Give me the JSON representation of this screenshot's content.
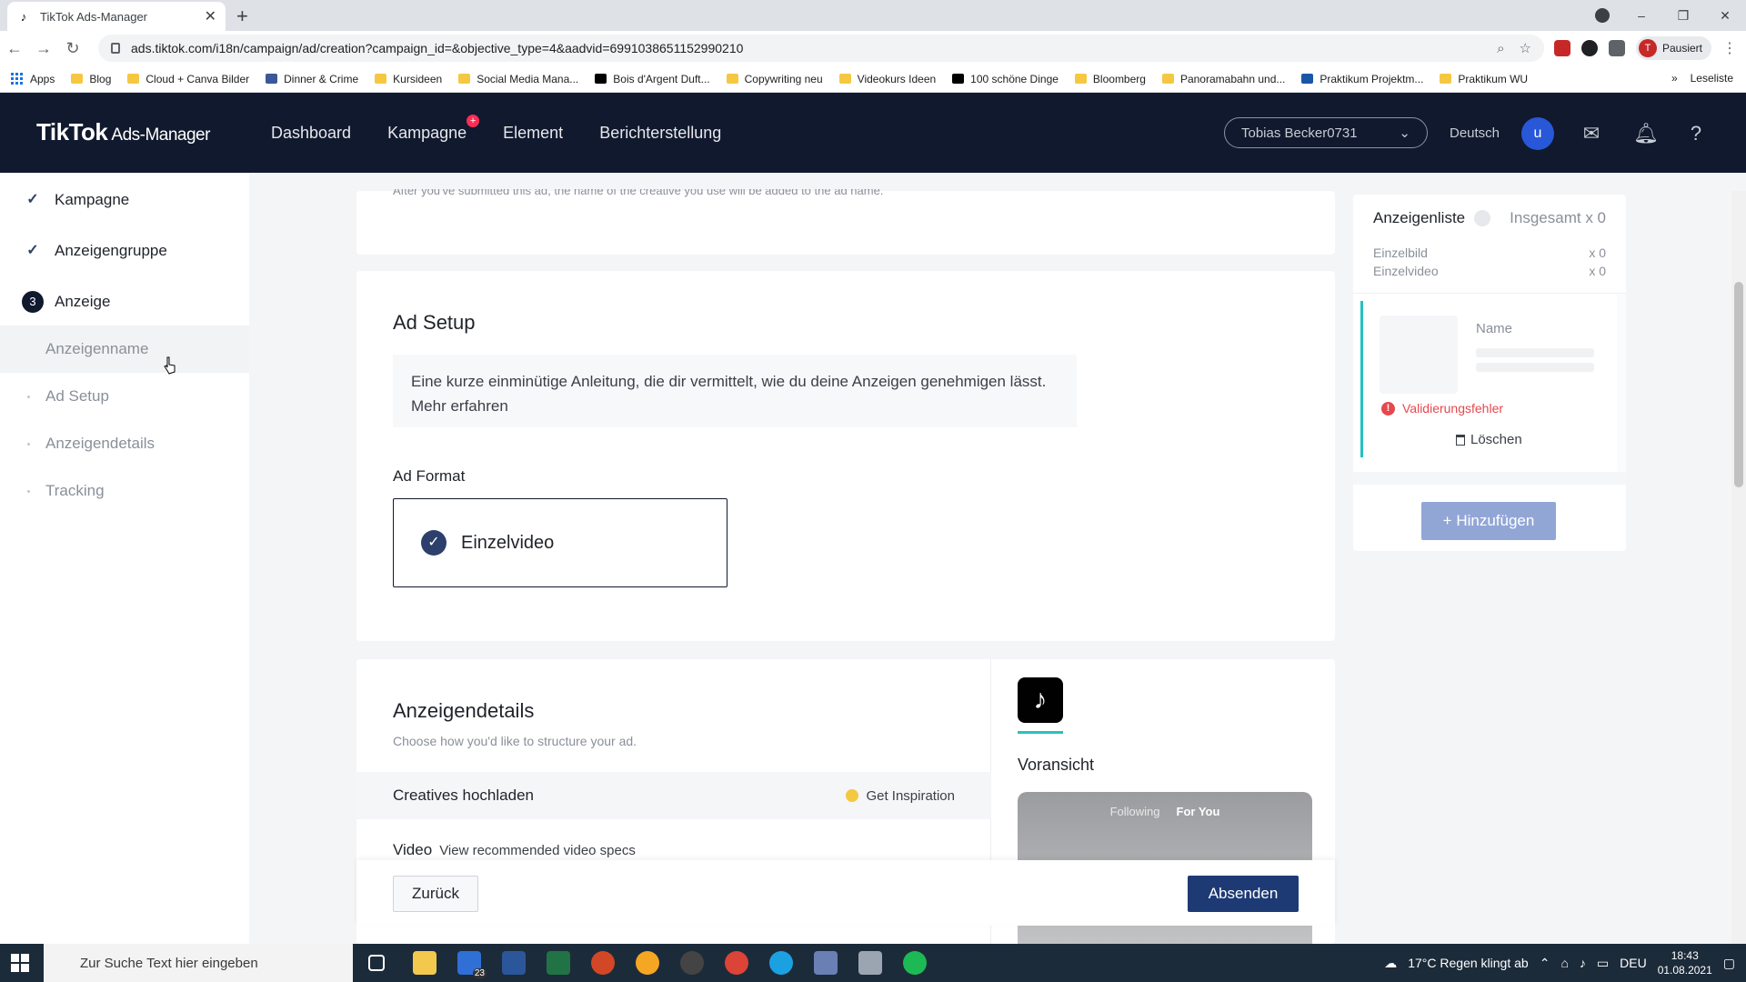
{
  "browser": {
    "tab_title": "TikTok Ads-Manager",
    "url": "ads.tiktok.com/i18n/campaign/ad/creation?campaign_id=&objective_type=4&aadvid=6991038651152990210",
    "profile_label": "Pausiert",
    "profile_initial": "T",
    "bookmarks": [
      "Apps",
      "Blog",
      "Cloud + Canva Bilder",
      "Dinner & Crime",
      "Kursideen",
      "Social Media Mana...",
      "Bois d'Argent Duft...",
      "Copywriting neu",
      "Videokurs Ideen",
      "100 schöne Dinge",
      "Bloomberg",
      "Panoramabahn und...",
      "Praktikum Projektm...",
      "Praktikum WU"
    ],
    "bookmarks_more": "»",
    "reading_list": "Leseliste"
  },
  "header": {
    "logo": "TikTok",
    "logo_sub": "Ads-Manager",
    "nav": [
      "Dashboard",
      "Kampagne",
      "Element",
      "Berichterstellung"
    ],
    "account": "Tobias Becker0731",
    "language": "Deutsch",
    "user_initial": "u"
  },
  "sidebar": {
    "steps": [
      {
        "label": "Kampagne",
        "state": "done"
      },
      {
        "label": "Anzeigengruppe",
        "state": "done"
      },
      {
        "label": "Anzeige",
        "state": "current",
        "number": "3"
      }
    ],
    "substeps": [
      "Anzeigenname",
      "Ad Setup",
      "Anzeigendetails",
      "Tracking"
    ]
  },
  "main": {
    "cut_text": "After you've submitted this ad, the name of the creative you use will be added to the ad name.",
    "ad_setup": {
      "title": "Ad Setup",
      "info": "Eine kurze einminütige Anleitung, die dir vermittelt, wie du deine Anzeigen genehmigen lässt.",
      "info_link": "Mehr erfahren",
      "format_label": "Ad Format",
      "format_option": "Einzelvideo"
    },
    "details": {
      "title": "Anzeigendetails",
      "subtitle": "Choose how you'd like to structure your ad.",
      "upload_label": "Creatives hochladen",
      "inspiration": "Get Inspiration",
      "video_label": "Video",
      "video_specs": "View recommended video specs",
      "preview_label": "Voransicht",
      "phone_tab_following": "Following",
      "phone_tab_foryou": "For You"
    },
    "actions": {
      "back": "Zurück",
      "submit": "Absenden"
    }
  },
  "right_panel": {
    "title": "Anzeigenliste",
    "total": "Insgesamt x 0",
    "rows": [
      {
        "label": "Einzelbild",
        "count": "x 0"
      },
      {
        "label": "Einzelvideo",
        "count": "x 0"
      }
    ],
    "item_name": "Name",
    "error": "Validierungsfehler",
    "delete": "Löschen",
    "add": "+ Hinzufügen"
  },
  "taskbar": {
    "search_placeholder": "Zur Suche Text hier eingeben",
    "badge": "23",
    "weather": "17°C  Regen klingt ab",
    "lang": "DEU",
    "time": "18:43",
    "date": "01.08.2021"
  },
  "colors": {
    "header_bg": "#10192d",
    "primary": "#1e3a74",
    "accent_teal": "#25c2c0",
    "error": "#e5484d",
    "tiktok_red": "#fe2c55"
  }
}
